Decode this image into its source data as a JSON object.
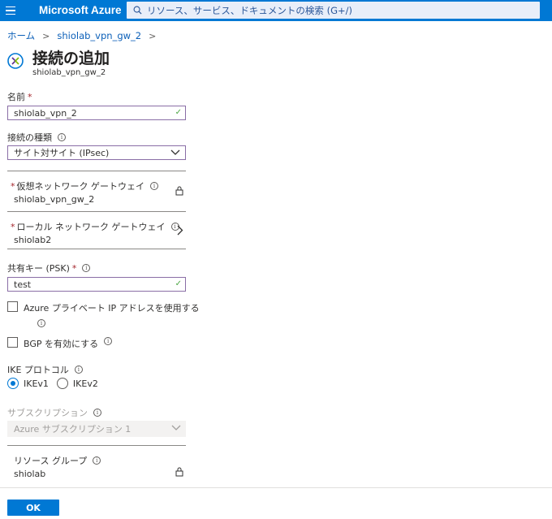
{
  "topbar": {
    "brand": "Microsoft Azure",
    "search_placeholder": "リソース、サービス、ドキュメントの検索 (G+/)"
  },
  "breadcrumb": {
    "home": "ホーム",
    "gateway": "shiolab_vpn_gw_2"
  },
  "page": {
    "title": "接続の追加",
    "subtitle": "shiolab_vpn_gw_2"
  },
  "form": {
    "name": {
      "label": "名前",
      "required": "*",
      "value": "shiolab_vpn_2"
    },
    "connection_type": {
      "label": "接続の種類",
      "value": "サイト対サイト (IPsec)"
    },
    "vnet_gateway": {
      "required": "*",
      "label": "仮想ネットワーク ゲートウェイ",
      "value": "shiolab_vpn_gw_2"
    },
    "local_gateway": {
      "required": "*",
      "label": "ローカル ネットワーク ゲートウェイ",
      "value": "shiolab2"
    },
    "psk": {
      "label": "共有キー (PSK)",
      "required": "*",
      "value": "test"
    },
    "private_ip": {
      "label": "Azure プライベート IP アドレスを使用する",
      "checked": false
    },
    "bgp": {
      "label": "BGP を有効にする",
      "checked": false
    },
    "ike": {
      "label": "IKE プロトコル",
      "options": [
        "IKEv1",
        "IKEv2"
      ],
      "selected": "IKEv1"
    },
    "subscription": {
      "label": "サブスクリプション",
      "value": "Azure サブスクリプション 1"
    },
    "resource_group": {
      "label": "リソース グループ",
      "value": "shiolab"
    }
  },
  "footer": {
    "ok_label": "OK"
  },
  "colors": {
    "accent": "#0078d4",
    "required": "#a4262c",
    "valid": "#4ca745"
  },
  "info_glyph": "i",
  "check_glyph": "✓"
}
